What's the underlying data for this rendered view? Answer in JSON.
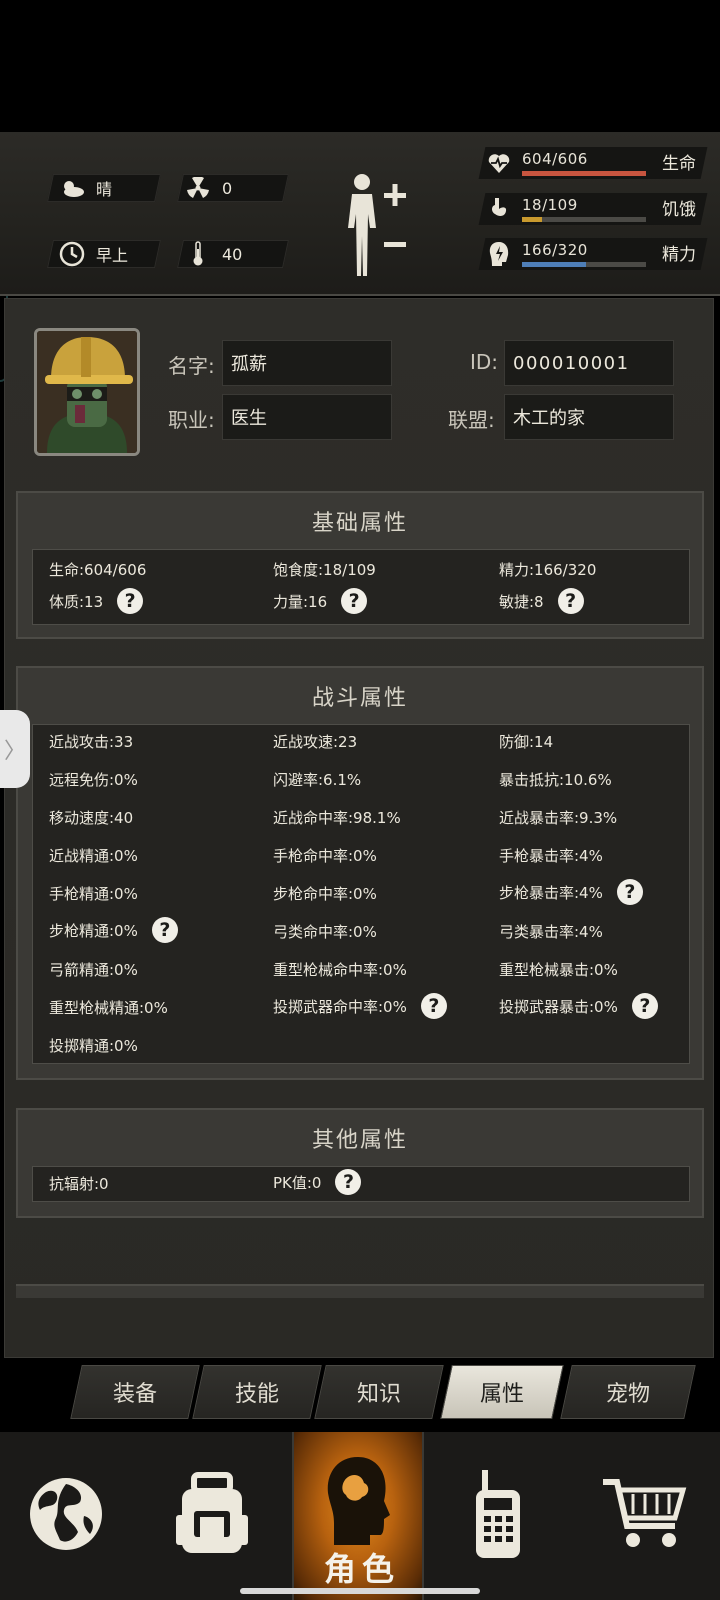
{
  "hud": {
    "weather": "晴",
    "radiation": "0",
    "time_of_day": "早上",
    "temperature": "40",
    "health": {
      "value": "604/606",
      "label": "生命",
      "ratio": 0.997,
      "color": "#c8553f"
    },
    "hunger": {
      "value": "18/109",
      "label": "饥饿",
      "ratio": 0.165,
      "color": "#c99a2e"
    },
    "energy": {
      "value": "166/320",
      "label": "精力",
      "ratio": 0.519,
      "color": "#4f7fb8"
    }
  },
  "profile": {
    "name_label": "名字:",
    "name": "孤薪",
    "id_label": "ID:",
    "id": "000010001",
    "job_label": "职业:",
    "job": "医生",
    "alliance_label": "联盟:",
    "alliance": "木工的家"
  },
  "basic": {
    "title": "基础属性",
    "life": "生命:604/606",
    "satiety": "饱食度:18/109",
    "energy": "精力:166/320",
    "constitution": "体质:13",
    "strength": "力量:16",
    "agility": "敏捷:8"
  },
  "combat": {
    "title": "战斗属性",
    "rows": [
      [
        "近战攻击:33",
        "近战攻速:23",
        "防御:14"
      ],
      [
        "远程免伤:0%",
        "闪避率:6.1%",
        "暴击抵抗:10.6%"
      ],
      [
        "移动速度:40",
        "近战命中率:98.1%",
        "近战暴击率:9.3%"
      ],
      [
        "近战精通:0%",
        "手枪命中率:0%",
        "手枪暴击率:4%"
      ],
      [
        "手枪精通:0%",
        "步枪命中率:0%",
        "步枪暴击率:4%"
      ],
      [
        "步枪精通:0%",
        "弓类命中率:0%",
        "弓类暴击率:4%"
      ],
      [
        "弓箭精通:0%",
        "重型枪械命中率:0%",
        "重型枪械暴击:0%"
      ],
      [
        "重型枪械精通:0%",
        "投掷武器命中率:0%",
        "投掷武器暴击:0%"
      ],
      [
        "投掷精通:0%",
        "",
        ""
      ]
    ]
  },
  "other": {
    "title": "其他属性",
    "radiation_resist": "抗辐射:0",
    "pk_value": "PK值:0"
  },
  "help_mark": "?",
  "subtabs": [
    "装备",
    "技能",
    "知识",
    "属性",
    "宠物"
  ],
  "nav": {
    "active_label": "角色"
  }
}
